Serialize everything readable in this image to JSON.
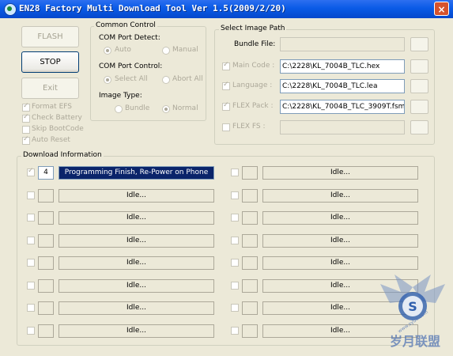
{
  "window": {
    "title": "EN28 Factory Multi Download Tool Ver 1.5(2009/2/20)",
    "close_glyph": "×"
  },
  "buttons": {
    "flash": "FLASH",
    "stop": "STOP",
    "exit": "Exit"
  },
  "options": {
    "format_efs": "Format EFS",
    "check_battery": "Check Battery",
    "skip_bootcode": "Skip BootCode",
    "auto_reset": "Auto Reset"
  },
  "common_control": {
    "legend": "Common Control",
    "com_port_detect": "COM Port Detect:",
    "auto": "Auto",
    "manual": "Manual",
    "com_port_control": "COM Port Control:",
    "select_all": "Select All",
    "abort_all": "Abort All",
    "image_type": "Image Type:",
    "bundle": "Bundle",
    "normal": "Normal"
  },
  "image_path": {
    "legend": "Select Image Path",
    "bundle_file": "Bundle File:",
    "main_code": "Main Code :",
    "main_code_value": "C:\\2228\\KL_7004B_TLC.hex",
    "language": "Language :",
    "language_value": "C:\\2228\\KL_7004B_TLC.lea",
    "flex_pack": "FLEX Pack :",
    "flex_pack_value": "C:\\2228\\KL_7004B_TLC_3909T.fsm",
    "flex_fs": "FLEX FS :"
  },
  "download": {
    "legend": "Download Information",
    "slots_left": [
      {
        "num": "4",
        "status": "Programming Finish, Re-Power on Phone",
        "active": true
      },
      {
        "num": "",
        "status": "Idle...",
        "active": false
      },
      {
        "num": "",
        "status": "Idle...",
        "active": false
      },
      {
        "num": "",
        "status": "Idle...",
        "active": false
      },
      {
        "num": "",
        "status": "Idle...",
        "active": false
      },
      {
        "num": "",
        "status": "Idle...",
        "active": false
      },
      {
        "num": "",
        "status": "Idle...",
        "active": false
      },
      {
        "num": "",
        "status": "Idle...",
        "active": false
      }
    ],
    "slots_right": [
      {
        "num": "",
        "status": "Idle...",
        "active": false
      },
      {
        "num": "",
        "status": "Idle...",
        "active": false
      },
      {
        "num": "",
        "status": "Idle...",
        "active": false
      },
      {
        "num": "",
        "status": "Idle...",
        "active": false
      },
      {
        "num": "",
        "status": "Idle...",
        "active": false
      },
      {
        "num": "",
        "status": "Idle...",
        "active": false
      },
      {
        "num": "",
        "status": "Idle...",
        "active": false
      },
      {
        "num": "",
        "status": "Idle...",
        "active": false
      }
    ]
  },
  "watermark": {
    "text": "岁月联盟",
    "url": "www.syue.com",
    "letter": "S"
  }
}
